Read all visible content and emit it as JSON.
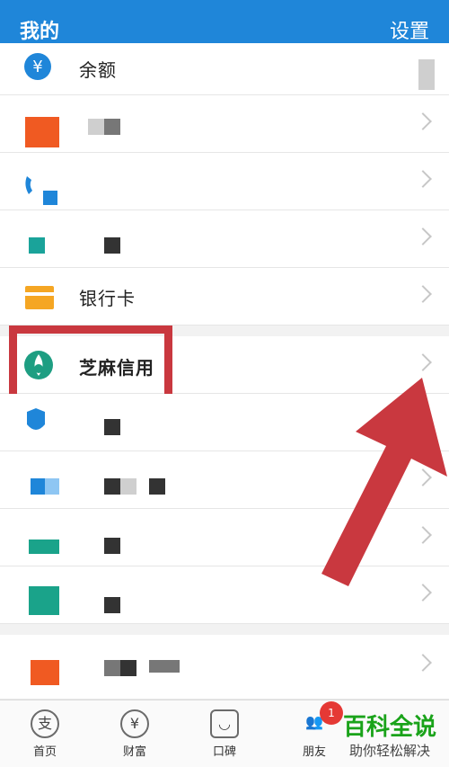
{
  "header": {
    "title": "我的",
    "settings_label": "设置"
  },
  "rows": {
    "balance": {
      "label": "余额",
      "icon": "yen-icon"
    },
    "bank_card": {
      "label": "银行卡",
      "icon": "card-icon"
    },
    "zhima": {
      "label": "芝麻信用",
      "icon": "zhima-icon"
    }
  },
  "tabs": {
    "home": {
      "label": "首页",
      "icon": "支"
    },
    "wealth": {
      "label": "财富",
      "icon": "¥"
    },
    "koubei": {
      "label": "口碑",
      "icon": "◡"
    },
    "friends": {
      "label": "朋友",
      "icon": "👥"
    }
  },
  "friends_badge": "1",
  "watermark": {
    "line1": "百科全说",
    "line2": "助你轻松解决"
  },
  "colors": {
    "header": "#1f86d9",
    "highlight": "#c9383f",
    "watermark": "#1aa31a"
  }
}
